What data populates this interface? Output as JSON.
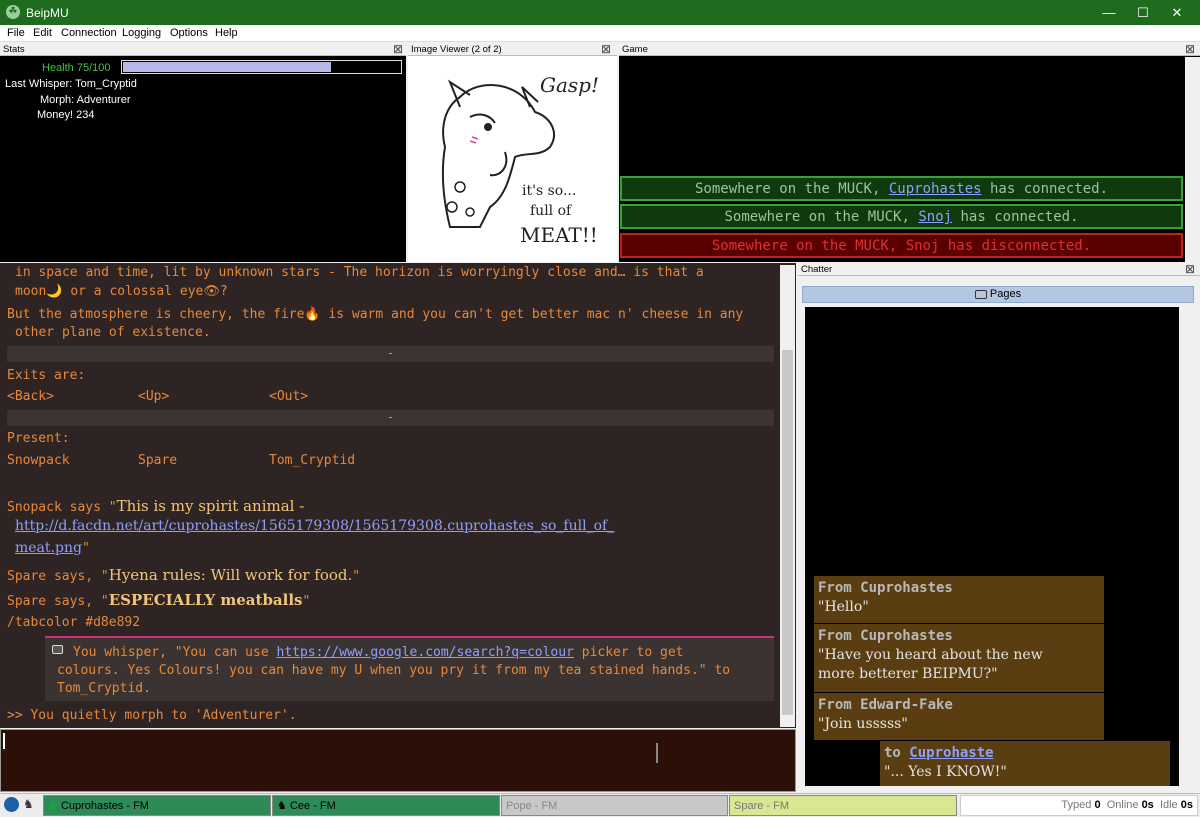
{
  "window": {
    "title": "BeipMU",
    "minimize": "—",
    "maximize": "☐",
    "close": "✕"
  },
  "menu": [
    "File",
    "Edit",
    "Connection",
    "Logging",
    "Options",
    "Help"
  ],
  "panels": {
    "stats_title": "Stats",
    "image_viewer_title": "Image Viewer (2 of 2)",
    "game_title": "Game",
    "chatter_title": "Chatter",
    "close_glyph": "⊠"
  },
  "stats": {
    "health_label": "Health 75/100",
    "health_fraction": 0.75,
    "last_whisper": "Last Whisper: Tom_Cryptid",
    "morph": "Morph: Adventurer",
    "money": "Money! 234"
  },
  "image": {
    "text_top": "Gasp!",
    "text_bottom_1": "it's so...",
    "text_bottom_2": "full of",
    "text_bottom_3": "MEAT!!"
  },
  "game": {
    "connections": [
      {
        "pre": "Somewhere on the MUCK, ",
        "name": "Cuprohastes",
        "post": " has connected.",
        "status": "connected"
      },
      {
        "pre": "Somewhere on the MUCK, ",
        "name": "Snoj",
        "post": " has connected.",
        "status": "connected"
      },
      {
        "pre": "Somewhere on the MUCK, Snoj has disconnected.",
        "name": "",
        "post": "",
        "status": "disconnected"
      }
    ]
  },
  "main": {
    "line1": "in space and time, lit by unknown stars - The horizon is worryingly close and… is that a",
    "line2": "moon🌙 or a colossal eye👁?",
    "line3": "But the atmosphere is cheery, the fire🔥 is warm and you can't get better mac n' cheese in any",
    "line4": "other plane of existence.",
    "sep": "-",
    "exits_label": "Exits are:",
    "exits": [
      "<Back>",
      "<Up>",
      "<Out>"
    ],
    "present_label": "Present:",
    "present": [
      "Snowpack",
      "Spare",
      "Tom_Cryptid"
    ],
    "snopack_pre": "Snopack says \"",
    "snopack_text": "This is my spirit animal -",
    "snopack_link1": "http://d.facdn.net/art/cuprohastes/1565179308/1565179308.cuprohastes_so_full_of_",
    "snopack_link2": "meat.png",
    "quote_close": "\"",
    "spare1_pre": "Spare says, \"",
    "spare1_text": "Hyena rules: Will work for food.",
    "spare2_pre": "Spare says, \"",
    "spare2_text": "ESPECIALLY meatballs",
    "tabcolor": "/tabcolor #d8e892",
    "whisper_pre": "You whisper, \"You can use ",
    "whisper_link": "https://www.google.com/search?q=colour",
    "whisper_post": " picker to get",
    "whisper_line2": "colours. Yes Colours! you can have my U when you pry it from my tea stained hands.\" to",
    "whisper_line3": "Tom_Cryptid.",
    "morph_msg": ">> You quietly morph to 'Adventurer'."
  },
  "chatter": {
    "pages_label": "Pages",
    "messages": [
      {
        "header": "From Cuprohastes",
        "body": "\"Hello\""
      },
      {
        "header": "From Cuprohastes",
        "body1": "\"Have you heard about the new",
        "body2": "more betterer BEIPMU?\""
      },
      {
        "header": "From Edward-Fake",
        "body": "\"Join usssss\""
      },
      {
        "to": "to ",
        "name": "Cuprohaste",
        "body": "\"... Yes I KNOW!\""
      }
    ]
  },
  "statusbar": {
    "tabs": [
      "Cuprohastes - FM",
      "Cee - FM",
      "Pope - FM",
      "Spare - FM"
    ],
    "typed_label": "Typed",
    "typed": "0",
    "online_label": "Online",
    "online": "0s",
    "idle_label": "Idle",
    "idle": "0s"
  },
  "colors": {
    "accent": "#1f6c1f",
    "text": "#e7883a",
    "connected": "#2e6b2e",
    "disconnected": "#6b0000",
    "tab_green": "#2e8b57",
    "tab_yellow": "#d8e892"
  }
}
